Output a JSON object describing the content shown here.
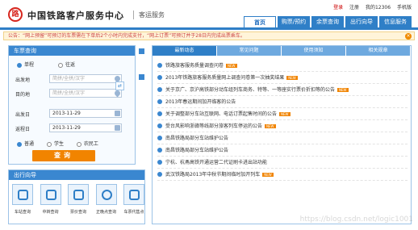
{
  "header": {
    "logo_glyph": "路",
    "brand": "中国铁路客户服务中心",
    "sub": "客运服务",
    "links": [
      "登录",
      "注册",
      "我的12306",
      "手机版"
    ],
    "nav": [
      "首页",
      "购票/预约",
      "余票查询",
      "出行向导",
      "信息服务"
    ]
  },
  "notice": {
    "text": "公告：“网上预留”可预订的车票需在下单后2个小时内完成支付，“网上订票”可预订并于28日内完成出票乘车。",
    "close": "×"
  },
  "ticket": {
    "title": "车票查询",
    "trip_types": [
      "单程",
      "往返"
    ],
    "fields": [
      {
        "label": "出发地",
        "placeholder": "简拼/全拼/汉字"
      },
      {
        "label": "目的地",
        "placeholder": "简拼/全拼/汉字"
      },
      {
        "label": "出发日",
        "value": "2013-11-29"
      },
      {
        "label": "返程日",
        "value": "2013-11-29"
      }
    ],
    "passenger_types": [
      "普通",
      "学生",
      "农民工"
    ],
    "swap": "⇄",
    "query": "查询"
  },
  "guide": {
    "title": "出行向导",
    "items": [
      "车站查询",
      "中转查询",
      "票价查询",
      "正晚点查询",
      "车票代售点"
    ]
  },
  "news": {
    "tabs": [
      "最新动态",
      "常见问题",
      "使用须知",
      "相关规章"
    ],
    "items": [
      {
        "text": "铁路旅客服务质量调查问卷",
        "new": "NEW"
      },
      {
        "text": "2013年铁路旅客服务质量网上调查问卷第一次抽奖结果",
        "new": "NEW"
      },
      {
        "text": "关于京广、京沪高铁部分动车组列车商务、特等、一等座实行票价折扣等的公告",
        "new": "NEW"
      },
      {
        "text": "2013年春运期间加开临客的公告"
      },
      {
        "text": "关于调整部分车站互联网、电话订票起售时间的公告",
        "new": "NEW"
      },
      {
        "text": "受台风影响浙赣等线部分旅客列车停运的公告",
        "new": "NEW"
      },
      {
        "text": "南昌铁路局部分车站维护公告"
      },
      {
        "text": "南昌铁路局部分车站维护公告"
      },
      {
        "text": "宁杭、杭甬高铁开通运营二代证刷卡进出站功能"
      },
      {
        "text": "武汉铁路局2013年中秋节期间临时加开列车",
        "new": "NEW"
      }
    ]
  },
  "watermark": "https://blog.csdn.net/logic1001",
  "colors": {
    "primary": "#2f7fc7",
    "accent": "#f18400"
  }
}
